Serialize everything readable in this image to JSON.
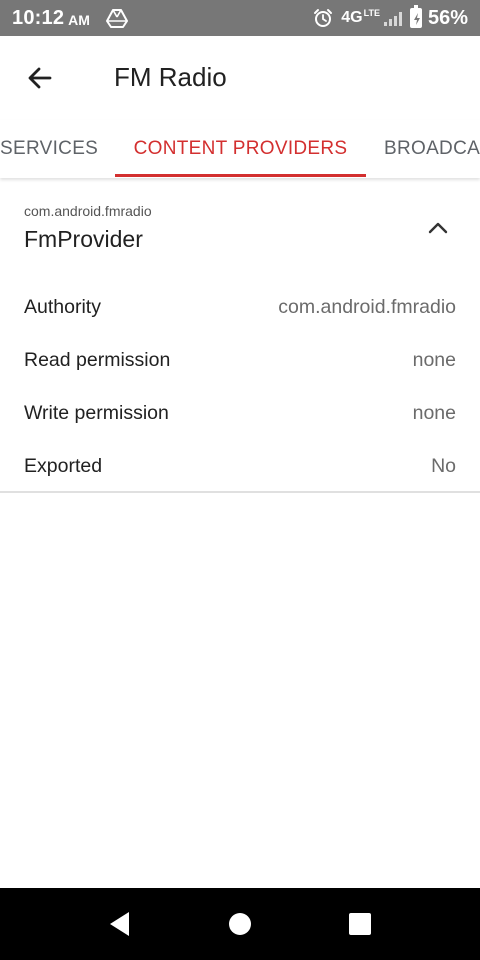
{
  "status_bar": {
    "time": "10:12",
    "ampm": "AM",
    "network": "4G",
    "network_sub": "LTE",
    "battery_percent": "56%",
    "icons": [
      "drive-icon",
      "alarm-icon",
      "signal-icon",
      "battery-icon"
    ]
  },
  "toolbar": {
    "title": "FM Radio",
    "back_icon": "arrow-back-icon"
  },
  "tabs": [
    {
      "label": "SERVICES",
      "active": false
    },
    {
      "label": "CONTENT PROVIDERS",
      "active": true
    },
    {
      "label": "BROADCA",
      "active": false
    }
  ],
  "provider": {
    "package": "com.android.fmradio",
    "name": "FmProvider",
    "expanded": true,
    "details": [
      {
        "label": "Authority",
        "value": "com.android.fmradio"
      },
      {
        "label": "Read permission",
        "value": "none"
      },
      {
        "label": "Write permission",
        "value": "none"
      },
      {
        "label": "Exported",
        "value": "No"
      }
    ]
  },
  "colors": {
    "accent": "#d32f2f",
    "status_bar": "#777777",
    "nav_bar": "#000000"
  },
  "nav_bar": {
    "icons": [
      "nav-back-icon",
      "nav-home-icon",
      "nav-recents-icon"
    ]
  }
}
